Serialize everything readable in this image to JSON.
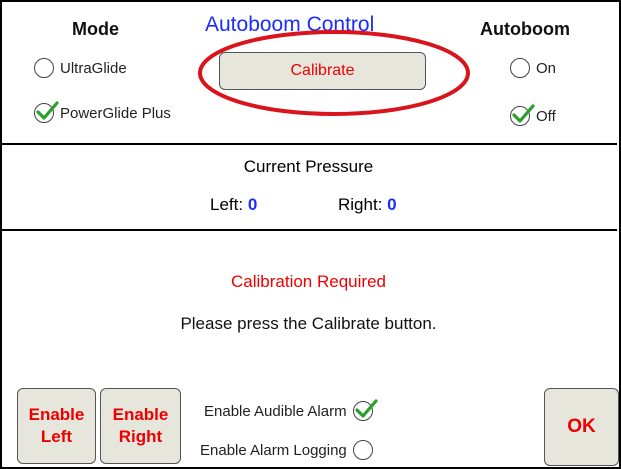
{
  "header": {
    "title": "Autoboom Control",
    "mode_label": "Mode",
    "autoboom_label": "Autoboom"
  },
  "mode_options": {
    "ultraglide": {
      "label": "UltraGlide",
      "checked": false
    },
    "powerglide": {
      "label": "PowerGlide Plus",
      "checked": true
    }
  },
  "autoboom_options": {
    "on": {
      "label": "On",
      "checked": false
    },
    "off": {
      "label": "Off",
      "checked": true
    }
  },
  "calibrate_label": "Calibrate",
  "pressure": {
    "title": "Current Pressure",
    "left_label": "Left:",
    "left_value": "0",
    "right_label": "Right:",
    "right_value": "0"
  },
  "status": {
    "title": "Calibration Required",
    "message": "Please press the Calibrate button."
  },
  "buttons": {
    "enable_left_line1": "Enable",
    "enable_left_line2": "Left",
    "enable_right_line1": "Enable",
    "enable_right_line2": "Right",
    "ok": "OK"
  },
  "alarms": {
    "audible": {
      "label": "Enable Audible Alarm",
      "checked": true
    },
    "logging": {
      "label": "Enable Alarm Logging",
      "checked": false
    }
  },
  "colors": {
    "title": "#1a2cff",
    "alert": "#ee0000",
    "check": "#2aa02a",
    "highlight": "#d9141c",
    "button_bg": "#e6e6dc"
  }
}
